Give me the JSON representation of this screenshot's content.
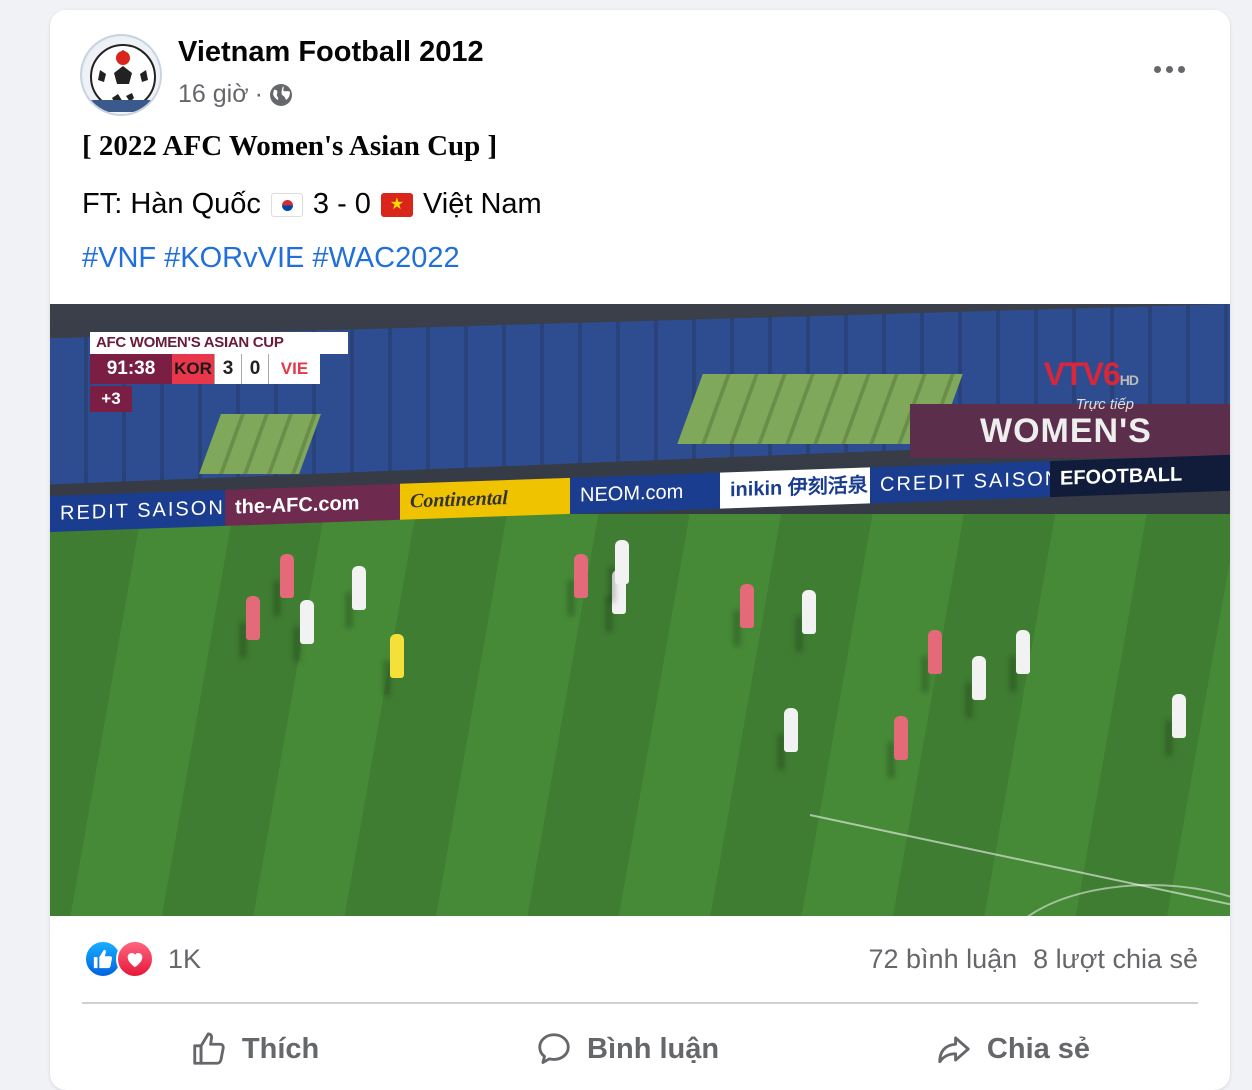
{
  "post": {
    "author": "Vietnam Football 2012",
    "time": "16 giờ",
    "separator": "·",
    "privacy_icon": "globe-icon",
    "title": "[ 2022 AFC Women's Asian Cup ]",
    "score_line": {
      "prefix": "FT: Hàn Quốc",
      "score": "3 - 0",
      "suffix": "Việt Nam"
    },
    "hashtags": [
      "#VNF",
      "#KORvVIE",
      "#WAC2022"
    ]
  },
  "video": {
    "scoreboard": {
      "competition": "AFC WOMEN'S ASIAN CUP",
      "clock": "91:38",
      "home": "KOR",
      "home_score": "3",
      "away_score": "0",
      "away": "VIE",
      "added_time": "+3"
    },
    "broadcaster": "VTV6",
    "broadcaster_hd": "HD",
    "live_label": "Trực tiếp",
    "board_right": "WOMEN'S ASIA",
    "ads": [
      "REDIT SAISON",
      "the-AFC.com",
      "Continental",
      "NEOM.com",
      "inikin 伊刻活泉",
      "CREDIT SAISON",
      "EFOOTBALL"
    ]
  },
  "footer": {
    "reaction_count": "1K",
    "comments": "72 bình luận",
    "shares": "8 lượt chia sẻ",
    "actions": {
      "like": "Thích",
      "comment": "Bình luận",
      "share": "Chia sẻ"
    }
  },
  "colors": {
    "link": "#216fdb",
    "muted": "#65676b",
    "like_blue": "#0062df",
    "love_red": "#e61739"
  }
}
